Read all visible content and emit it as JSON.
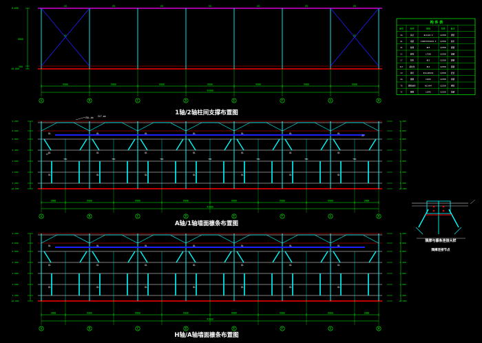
{
  "colors": {
    "background": "#000000",
    "dim": "#00ff00",
    "column": "#00ffff",
    "beam": "#ff0000",
    "ridge": "#ff00ff",
    "brace": "#1e1eff",
    "purlin": "#ffffff",
    "label": "#ffffff",
    "title": "#ffffff",
    "table": "#00ff00"
  },
  "axes": [
    "A",
    "B",
    "C",
    "D",
    "E",
    "F",
    "G",
    "H"
  ],
  "view1": {
    "title": "1轴/2轴柱间支撑布置图",
    "top_labels": [
      "XG",
      "XG",
      "XG",
      "XG",
      "XG",
      "XG",
      "XG"
    ],
    "bay_dims": [
      "6000",
      "6000",
      "6000",
      "6000",
      "6000",
      "6000",
      "6000"
    ],
    "total_dim": "42000",
    "brace_label": "ZC",
    "elev_top": "8.000",
    "elev_bottom": "±0.000",
    "height_dims": [
      "8000",
      "500"
    ]
  },
  "view2": {
    "title": "A轴/1轴墙面檩条布置图",
    "elev_labels": [
      "9.200",
      "8.000",
      "6.800",
      "5.400",
      "4.000",
      "2.600",
      "1.200",
      "±0.000"
    ],
    "purlin_label": "QL",
    "tie_label": "LT",
    "side_label": "ZZ",
    "door_labels": [
      "YMC",
      "YMC",
      "YMC",
      "YMC",
      "YMC",
      "YMC",
      "YMC"
    ],
    "note_left": "ZQL-ab",
    "note_right": "ZLT-ab",
    "bay_dims": [
      "3000",
      "6000",
      "6000",
      "6000",
      "6000",
      "6000",
      "6000",
      "3000"
    ],
    "total_dim": "42000"
  },
  "view3": {
    "title": "H轴/A轴墙面檩条布置图",
    "elev_labels": [
      "9.200",
      "8.000",
      "6.800",
      "5.400",
      "4.000",
      "2.600",
      "1.200",
      "±0.000"
    ],
    "purlin_label": "QL",
    "bay_dims": [
      "3000",
      "6000",
      "6000",
      "6000",
      "6000",
      "6000",
      "6000",
      "3000"
    ],
    "total_dim": "42000"
  },
  "detail": {
    "title": "隅撑与檩条连接大样",
    "subtitle": "隅撑连接节点"
  },
  "table": {
    "title": "构 件 表",
    "headers": [
      "编号",
      "名称",
      "规格",
      "材质",
      "备注"
    ],
    "rows": [
      [
        "XG",
        "系杆",
        "Φ114X4.5",
        "Q235B",
        "钢管"
      ],
      [
        "QL",
        "墙梁",
        "C200X70X20X2.5",
        "Q235B",
        "檩条"
      ],
      [
        "ZC",
        "柱撑",
        "Φ25",
        "Q235B",
        "圆钢"
      ],
      [
        "CC",
        "檩托",
        "L75X6",
        "Q235B",
        "角钢"
      ],
      [
        "LT",
        "拉条",
        "Φ12",
        "Q235B",
        "圆钢"
      ],
      [
        "XLT",
        "斜拉条",
        "Φ12",
        "Q235B",
        "圆钢"
      ],
      [
        "CZ",
        "撑杆",
        "Φ12+Φ32X2",
        "Q235B",
        "套管"
      ],
      [
        "GG",
        "隅撑",
        "L50X5",
        "Q235B",
        "角钢"
      ],
      [
        "TG",
        "刚性系杆",
        "Φ114X4",
        "Q235B",
        "钢管"
      ],
      [
        "YC",
        "隅撑",
        "L50X5",
        "Q235B",
        "角钢"
      ]
    ]
  }
}
